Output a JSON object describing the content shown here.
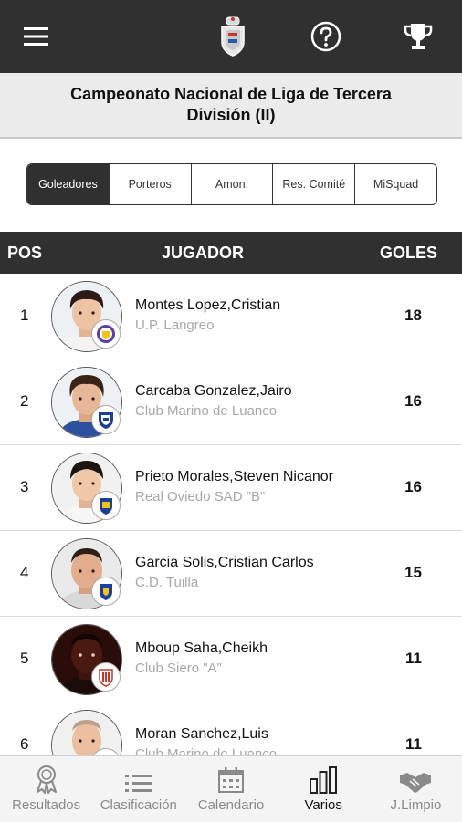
{
  "header": {
    "menu_icon": "hamburger-menu-icon",
    "logo_icon": "federation-crest-icon",
    "help_icon": "help-circle-icon",
    "trophy_icon": "trophy-icon"
  },
  "competition": {
    "title": "Campeonato Nacional de Liga de Tercera División (II)"
  },
  "segments": [
    {
      "label": "Goleadores",
      "active": true
    },
    {
      "label": "Porteros",
      "active": false
    },
    {
      "label": "Amon.",
      "active": false
    },
    {
      "label": "Res. Comité",
      "active": false
    },
    {
      "label": "MiSquad",
      "active": false
    }
  ],
  "table": {
    "headers": {
      "pos": "POS",
      "player": "JUGADOR",
      "goals": "GOLES"
    },
    "rows": [
      {
        "pos": "1",
        "name": "Montes Lopez,Cristian",
        "club": "U.P. Langreo",
        "goals": "18"
      },
      {
        "pos": "2",
        "name": "Carcaba Gonzalez,Jairo",
        "club": "Club Marino de Luanco",
        "goals": "16"
      },
      {
        "pos": "3",
        "name": "Prieto Morales,Steven Nicanor",
        "club": "Real Oviedo SAD \"B\"",
        "goals": "16"
      },
      {
        "pos": "4",
        "name": "Garcia Solis,Cristian Carlos",
        "club": "C.D. Tuilla",
        "goals": "15"
      },
      {
        "pos": "5",
        "name": "Mboup Saha,Cheikh",
        "club": "Club Siero \"A\"",
        "goals": "11"
      },
      {
        "pos": "6",
        "name": "Moran Sanchez,Luis",
        "club": "Club Marino de Luanco",
        "goals": "11"
      }
    ]
  },
  "bottom_nav": [
    {
      "label": "Resultados",
      "icon": "medal-icon",
      "active": false
    },
    {
      "label": "Clasificación",
      "icon": "list-icon",
      "active": false
    },
    {
      "label": "Calendario",
      "icon": "calendar-icon",
      "active": false
    },
    {
      "label": "Varios",
      "icon": "bar-chart-icon",
      "active": true
    },
    {
      "label": "J.Limpio",
      "icon": "handshake-icon",
      "active": false
    }
  ],
  "colors": {
    "bar": "#2f302f",
    "title_band": "#ebebeb",
    "muted_text": "#a8a8a8"
  }
}
